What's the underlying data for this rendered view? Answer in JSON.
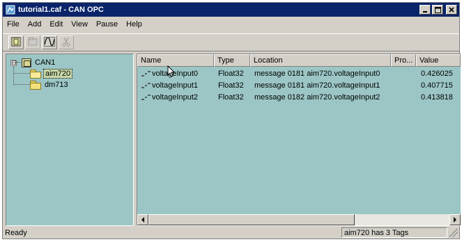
{
  "window": {
    "title": "tutorial1.caf - CAN OPC"
  },
  "menu": [
    "File",
    "Add",
    "Edit",
    "View",
    "Pause",
    "Help"
  ],
  "toolbar": {
    "buttons": [
      "add-device-icon",
      "add-module-icon",
      "add-tag-icon",
      "cut-icon"
    ]
  },
  "tree": {
    "root": {
      "label": "CAN1",
      "expander": "⊟"
    },
    "children": [
      {
        "label": "aim720",
        "selected": true
      },
      {
        "label": "dm713",
        "selected": false
      }
    ]
  },
  "list": {
    "headers": {
      "name": "Name",
      "type": "Type",
      "location": "Location",
      "pro": "Pro...",
      "value": "Value"
    },
    "rows": [
      {
        "name": "voltageInput0",
        "type": "Float32",
        "location": "message 0181 aim720.voltageInput0",
        "value": "0.426025"
      },
      {
        "name": "voltageInput1",
        "type": "Float32",
        "location": "message 0181 aim720.voltageInput1",
        "value": "0.407715"
      },
      {
        "name": "voltageInput2",
        "type": "Float32",
        "location": "message 0182 aim720.voltageInput2",
        "value": "0.413818"
      }
    ]
  },
  "status": {
    "left": "Ready",
    "right": "aim720 has 3 Tags"
  },
  "colors": {
    "title_bar": "#0a246a",
    "pane_background": "#9cc6c6",
    "chrome": "#d4d0c8"
  }
}
